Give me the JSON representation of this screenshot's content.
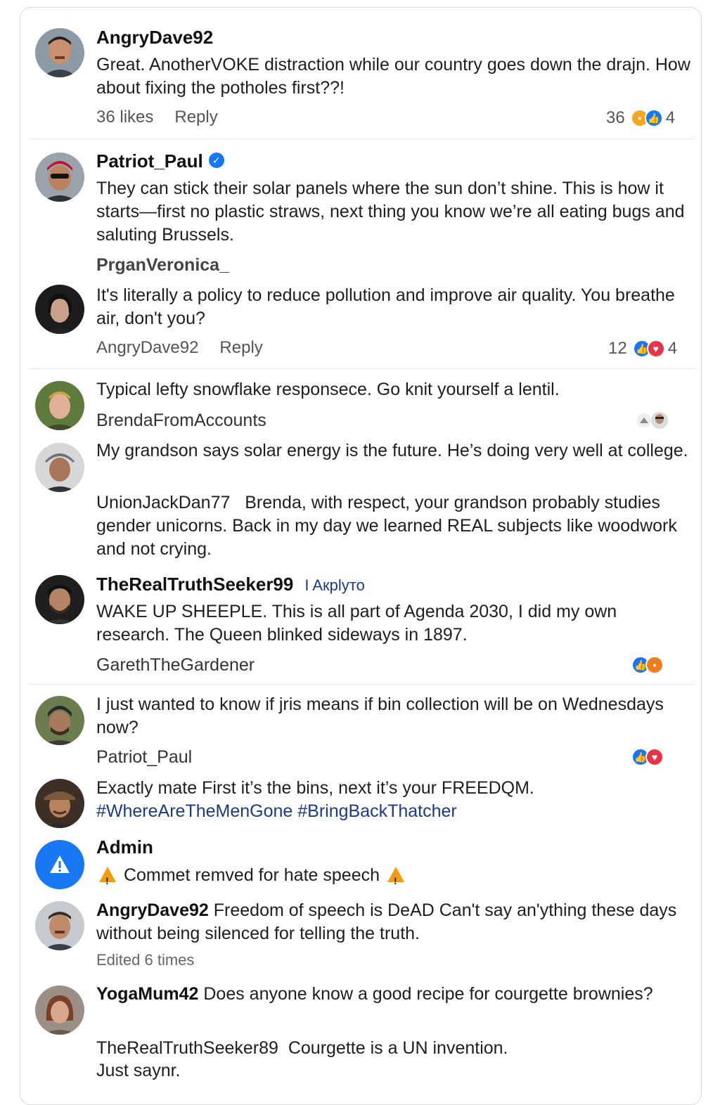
{
  "comments": {
    "c1": {
      "author": "AngryDave92",
      "text": "Great. AnotherVOKE distraction while our country goes down the drajn. How about fixing the potholes first??!",
      "likes": "36 likes",
      "reply": "Reply",
      "reaction_count_left": "36",
      "reaction_count_right": "4"
    },
    "c2": {
      "author": "Patriot_Paul",
      "text": "They can stick their solar panels where the sun don’t shine. This is how it starts—first no plastic straws, next thing you know we’re all eating bugs and saluting Brussels.",
      "next_user": "PrganVeronica_"
    },
    "c3": {
      "text": "It's literally a policy to reduce pollution and improve air quality. You breathe air, don't you?",
      "meta_user": "AngryDave92",
      "reply": "Reply",
      "reaction_count_left": "12",
      "reaction_count_right": "4"
    },
    "c4": {
      "text": "Typical lefty snowflake responsece. Go knit yourself a lentil.",
      "next_user": "BrendaFromAccounts"
    },
    "c5": {
      "text": "My grandson says solar energy is the future. He’s doing very well at college.",
      "reply_user": "UnionJackDan77",
      "reply_text": "Brenda, with respect, your grandson probably studies gender unicorns. Back in my day we learned REAL subjects like woodwork and not crying."
    },
    "c6": {
      "author": "TheRealTruthSeeker99",
      "reply_to": "I Aкplyто",
      "text": "WAKE UP SHEEPLE. This is all part of Agenda 2030, I did my own research. The Queen blinked sideways in 1897.",
      "next_user": "GarethTheGardener"
    },
    "c7": {
      "text": "I just wanted to know if jris means if bin collection will be on Wednesdays now?",
      "next_user": "Patriot_Paul"
    },
    "c8": {
      "text": "Exactly mate First it’s the bins, next it’s your FREEDQM.",
      "hashtags": "#WhereAreTheMenGone #BringBackThatcher"
    },
    "c9": {
      "author": "Admin",
      "text": "Commet remved for hate speech"
    },
    "c10": {
      "author": "AngryDave92",
      "text": "Freedom of speech is DeAD Can't say an'ything these days without being silenced for telling the truth.",
      "edited": "Edited 6 times"
    },
    "c11": {
      "author": "YogaMum42",
      "text": "Does anyone know a good recipe for courgette brownies?",
      "reply_user": "TheRealTruthSeeker89",
      "reply_text": "Courgette is a UN invention.",
      "reply_text_2": "Just saynr."
    }
  },
  "icons": {
    "like": "thumbs-up-icon",
    "love": "heart-icon",
    "haha": "haha-icon",
    "angry": "angry-icon",
    "warning": "warning-icon",
    "verified": "verified-check-icon"
  },
  "colors": {
    "like_blue": "#1877f2",
    "love_red": "#e8334a",
    "hashtag_blue": "#1b3a8c",
    "warning_orange": "#f39c12"
  }
}
